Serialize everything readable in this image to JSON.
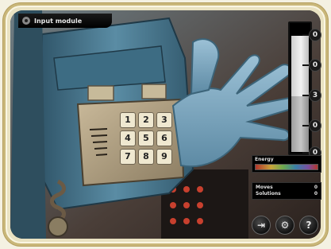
{
  "window": {
    "title": "Input module"
  },
  "keypad": {
    "keys": [
      "1",
      "2",
      "3",
      "4",
      "5",
      "6",
      "7",
      "8",
      "9"
    ]
  },
  "meter": {
    "ticks": [
      "0",
      "0",
      "3",
      "0",
      "0"
    ],
    "fill_level": 0.48
  },
  "energy": {
    "label": "Energy"
  },
  "stats": [
    {
      "label": "Moves",
      "value": "0"
    },
    {
      "label": "Solutions",
      "value": "0"
    }
  ],
  "buttons": [
    {
      "icon": "exit-icon",
      "glyph": "⇥"
    },
    {
      "icon": "gear-icon",
      "glyph": "⚙"
    },
    {
      "icon": "help-icon",
      "glyph": "?"
    }
  ],
  "colors": {
    "device_blue": "#4f7f96",
    "glove_blue": "#7fa6bf",
    "frame": "#e9e2c2"
  }
}
